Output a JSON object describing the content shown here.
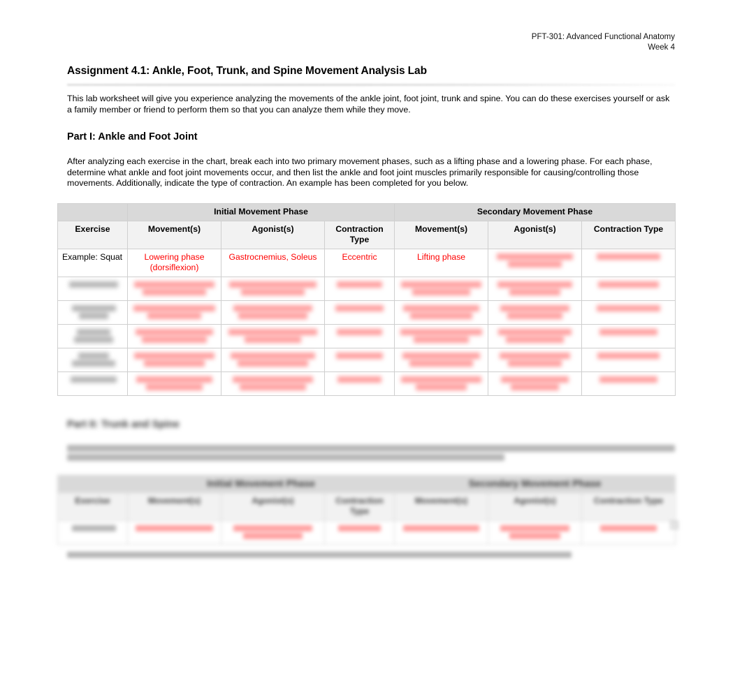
{
  "header": {
    "course": "PFT-301: Advanced Functional Anatomy",
    "week": "Week 4"
  },
  "title": "Assignment 4.1: Ankle, Foot, Trunk, and Spine Movement Analysis Lab",
  "intro": "This lab worksheet will give you experience analyzing the movements of the ankle joint, foot joint, trunk and spine. You can do these exercises yourself or ask a family member or friend to perform them so that you can analyze them while they move.",
  "part1": {
    "heading": "Part I: Ankle and Foot Joint",
    "paragraph": "After analyzing each exercise in the chart, break each into two primary movement phases, such as a lifting phase and a lowering phase. For each phase, determine what ankle and foot joint movements occur, and then list the ankle and foot joint muscles primarily responsible for causing/controlling those movements. Additionally, indicate the type of contraction. An example has been completed for you below.",
    "table": {
      "band": {
        "spacer": "",
        "initial": "Initial Movement Phase",
        "secondary": "Secondary Movement Phase"
      },
      "columns": [
        "Exercise",
        "Movement(s)",
        "Agonist(s)",
        "Contraction Type",
        "Movement(s)",
        "Agonist(s)",
        "Contraction Type"
      ],
      "example_row": {
        "exercise": "Example: Squat",
        "initial_movement": "Lowering phase (dorsiflexion)",
        "initial_agonist": "Gastrocnemius, Soleus",
        "initial_contraction": "Eccentric",
        "secondary_movement": "Lifting phase",
        "secondary_agonist": "",
        "secondary_contraction": ""
      },
      "blank_rows": 5
    }
  },
  "part2": {
    "heading": "Part II: Trunk and Spine",
    "paragraph": "",
    "note": "",
    "table": {
      "band": {
        "initial": "Initial Movement Phase",
        "secondary": "Secondary Movement Phase"
      },
      "columns": [
        "Exercise",
        "Movement(s)",
        "Agonist(s)",
        "Contraction Type",
        "Movement(s)",
        "Agonist(s)",
        "Contraction Type"
      ],
      "blank_rows": 1
    }
  },
  "colors": {
    "example_text": "#ff0000",
    "band_bg": "#d9d9d9",
    "colhead_bg": "#f2f2f2",
    "border": "#cfcfcf"
  }
}
